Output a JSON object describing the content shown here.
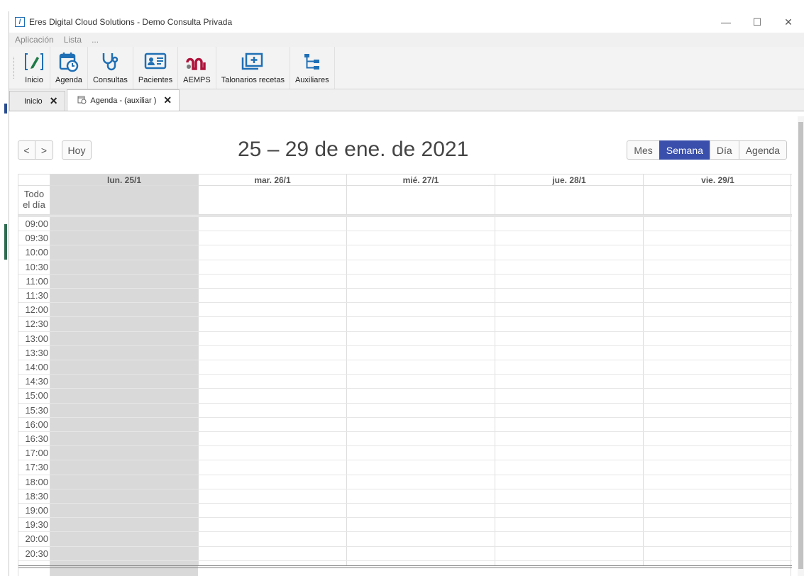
{
  "window": {
    "title": "Eres Digital Cloud Solutions - Demo Consulta Privada",
    "logo_glyph": "/",
    "controls": {
      "minimize": "—",
      "maximize": "☐",
      "close": "✕"
    }
  },
  "menu": {
    "items": [
      "Aplicación",
      "Lista",
      "..."
    ]
  },
  "ribbon": {
    "items": [
      {
        "label": "Inicio",
        "icon": "pen-bracket-icon"
      },
      {
        "label": "Agenda",
        "icon": "calendar-clock-icon"
      },
      {
        "label": "Consultas",
        "icon": "stethoscope-icon"
      },
      {
        "label": "Pacientes",
        "icon": "id-card-icon"
      },
      {
        "label": "AEMPS",
        "icon": "aemps-logo-icon"
      },
      {
        "label": "Talonarios recetas",
        "icon": "folder-plus-icon"
      },
      {
        "label": "Auxiliares",
        "icon": "tree-icon"
      }
    ]
  },
  "tabs": [
    {
      "label": "Inicio",
      "active": false
    },
    {
      "label": "Agenda - (auxiliar )",
      "active": true
    }
  ],
  "calendar": {
    "nav": {
      "prev": "<",
      "next": ">",
      "today": "Hoy"
    },
    "title": "25 – 29 de ene. de 2021",
    "views": [
      {
        "label": "Mes",
        "active": false
      },
      {
        "label": "Semana",
        "active": true
      },
      {
        "label": "Día",
        "active": false
      },
      {
        "label": "Agenda",
        "active": false
      }
    ],
    "days": [
      "lun. 25/1",
      "mar. 26/1",
      "mié. 27/1",
      "jue. 28/1",
      "vie. 29/1"
    ],
    "today_index": 0,
    "allday_label_1": "Todo",
    "allday_label_2": "el día",
    "times": [
      "09:00",
      "09:30",
      "10:00",
      "10:30",
      "11:00",
      "11:30",
      "12:00",
      "12:30",
      "13:00",
      "13:30",
      "14:00",
      "14:30",
      "15:00",
      "15:30",
      "16:00",
      "16:30",
      "17:00",
      "17:30",
      "18:00",
      "18:30",
      "19:00",
      "19:30",
      "20:00",
      "20:30"
    ]
  },
  "colors": {
    "accent": "#3a4fab",
    "today_bg": "#d9d9d9",
    "icon_blue": "#1f6fb5",
    "aemps_red": "#b0123b"
  }
}
